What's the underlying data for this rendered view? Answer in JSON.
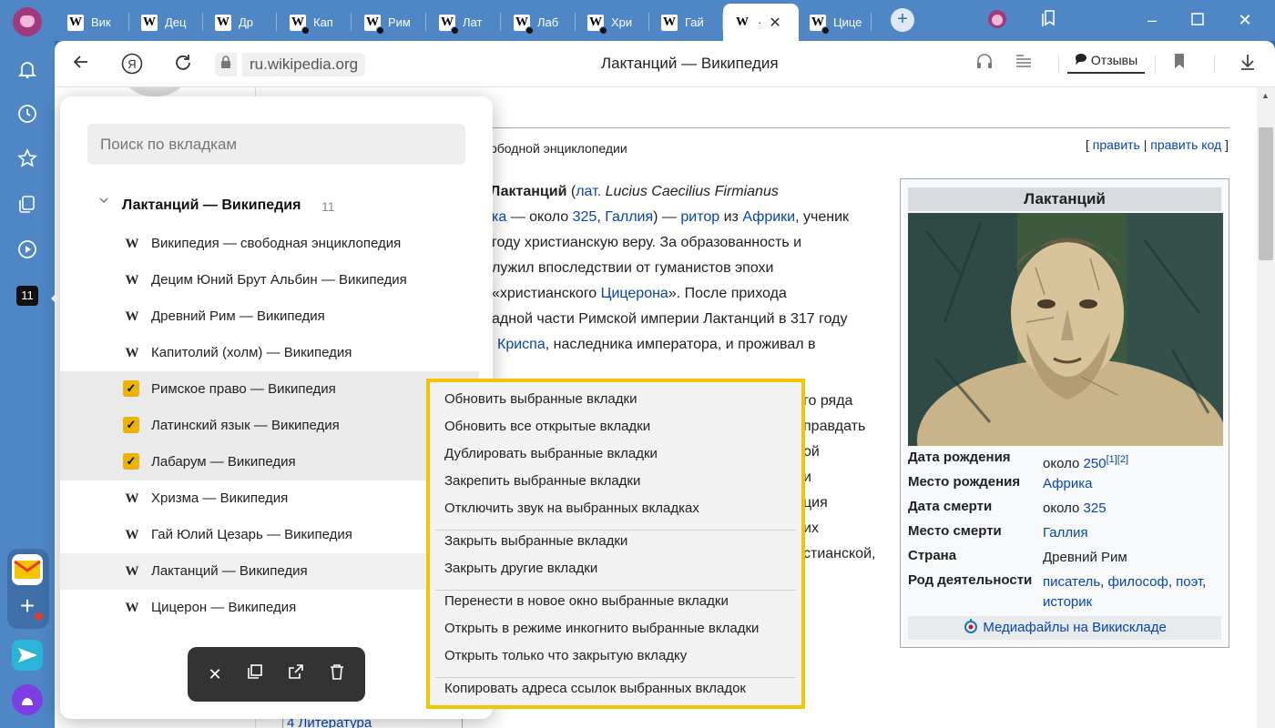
{
  "tabs": [
    {
      "label": "Вик",
      "dot": false
    },
    {
      "label": "Дец",
      "dot": false
    },
    {
      "label": "Др",
      "dot": false
    },
    {
      "label": "Кап",
      "dot": true
    },
    {
      "label": "Рим",
      "dot": true
    },
    {
      "label": "Лат",
      "dot": true
    },
    {
      "label": "Лаб",
      "dot": true
    },
    {
      "label": "Хри",
      "dot": true
    },
    {
      "label": "Гай",
      "dot": false
    },
    {
      "label": "·",
      "dot": false,
      "active": true
    },
    {
      "label": "Цице",
      "dot": true
    }
  ],
  "address": {
    "url": "ru.wikipedia.org",
    "title": "Лактанций — Википедия",
    "reviews": "Отзывы"
  },
  "sidebar": {
    "tabs_count": "11"
  },
  "tab_panel": {
    "search_placeholder": "Поиск по вкладкам",
    "group_title": "Лактанций — Википедия",
    "group_count": "11",
    "items": [
      {
        "label": "Википедия — свободная энциклопедия",
        "checked": false
      },
      {
        "label": "Децим Юний Брут Альбин — Википедия",
        "checked": false
      },
      {
        "label": "Древний Рим — Википедия",
        "checked": false
      },
      {
        "label": "Капитолий (холм) — Википедия",
        "checked": false
      },
      {
        "label": "Римское право — Википедия",
        "checked": true
      },
      {
        "label": "Латинский язык — Википедия",
        "checked": true
      },
      {
        "label": "Лабарум — Википедия",
        "checked": true
      },
      {
        "label": "Хризма — Википедия",
        "checked": false
      },
      {
        "label": "Гай Юлий Цезарь — Википедия",
        "checked": false
      },
      {
        "label": "Лактанций — Википедия",
        "checked": false,
        "current": true
      },
      {
        "label": "Цицерон — Википедия",
        "checked": false
      }
    ]
  },
  "context_menu": {
    "groups": [
      [
        "Обновить выбранные вкладки",
        "Обновить все открытые вкладки",
        "Дублировать выбранные вкладки",
        "Закрепить выбранные вкладки",
        "Отключить звук на выбранных вкладках"
      ],
      [
        "Закрыть выбранные вкладки",
        "Закрыть другие вкладки"
      ],
      [
        "Перенести в новое окно выбранные вкладки",
        "Открыть в режиме инкогнито выбранные вкладки",
        "Открыть только что закрытую вкладку"
      ],
      [
        "Копировать адреса ссылок выбранных вкладок"
      ]
    ]
  },
  "article": {
    "tagline": "ободной энциклопедии",
    "edit": "править",
    "edit_code": "править код",
    "body_lines": [
      [
        {
          "t": "Лактанций",
          "b": true
        },
        {
          "t": " ("
        },
        {
          "t": "лат.",
          "l": true
        },
        {
          "t": " "
        },
        {
          "t": "Lucius Caecilius Firmianus",
          "i": true
        }
      ],
      [
        {
          "t": "ка",
          "l": true
        },
        {
          "t": " — около "
        },
        {
          "t": "325",
          "l": true
        },
        {
          "t": ", "
        },
        {
          "t": "Галлия",
          "l": true
        },
        {
          "t": ") — "
        },
        {
          "t": "ритор",
          "l": true
        },
        {
          "t": " из "
        },
        {
          "t": "Африки",
          "l": true
        },
        {
          "t": ", ученик"
        }
      ],
      [
        {
          "t": "году христианскую веру. За образованность и"
        }
      ],
      [
        {
          "t": "лужил впоследствии от гуманистов эпохи"
        }
      ],
      [
        {
          "t": "«христианского "
        },
        {
          "t": "Цицерона",
          "l": true
        },
        {
          "t": "». После прихода"
        }
      ],
      [
        {
          "t": "адной части Римской империи Лактанций в 317 году"
        }
      ],
      [
        {
          "t": "Криспа",
          "l": true
        },
        {
          "t": ", наследника императора, и проживал в"
        }
      ]
    ],
    "right_fragments": [
      {
        "t": "го ряда",
        "l": false
      },
      {
        "t": "правдать",
        "l": false
      },
      {
        "t": "ой",
        "l": true
      },
      {
        "t": "и",
        "l": false
      },
      {
        "t": "ция",
        "l": false
      },
      {
        "t": "их",
        "l": false
      },
      {
        "t": "стианской,",
        "l": false
      }
    ],
    "toc_item": "4  Литература",
    "infobox": {
      "title": "Лактанций",
      "rows": [
        {
          "k": "Дата рождения",
          "v": [
            {
              "t": "около "
            },
            {
              "t": "250",
              "l": true
            },
            {
              "t": "[1][2]",
              "l": true,
              "sup": true
            }
          ]
        },
        {
          "k": "Место рождения",
          "v": [
            {
              "t": "Африка",
              "l": true
            }
          ]
        },
        {
          "k": "Дата смерти",
          "v": [
            {
              "t": "около "
            },
            {
              "t": "325",
              "l": true
            }
          ]
        },
        {
          "k": "Место смерти",
          "v": [
            {
              "t": "Галлия",
              "l": true
            }
          ]
        },
        {
          "k": "Страна",
          "v": [
            {
              "t": "Древний Рим"
            }
          ]
        },
        {
          "k": "Род деятельности",
          "v": [
            {
              "t": "писатель",
              "l": true
            },
            {
              "t": ", "
            },
            {
              "t": "философ",
              "l": true
            },
            {
              "t": ", "
            },
            {
              "t": "поэт",
              "l": true
            },
            {
              "t": ", "
            },
            {
              "t": "историк",
              "l": true
            }
          ]
        }
      ],
      "commons": "Медиафайлы на Викискладе"
    }
  },
  "colors": {
    "chrome": "#4f86c6",
    "highlight": "#f5c400",
    "checkbox": "#ebb400",
    "link": "#0645ad"
  }
}
